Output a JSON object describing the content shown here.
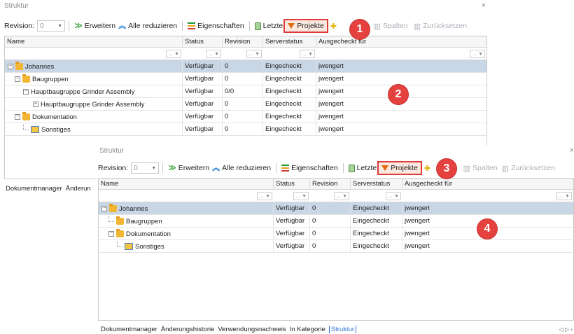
{
  "back": {
    "title": "Struktur",
    "close": "×",
    "toolbar": {
      "revision_label": "Revision:",
      "revision_value": "0",
      "expand": "Erweitern",
      "collapse": "Alle reduzieren",
      "properties": "Eigenschaften",
      "recent": "Letzte",
      "projects": "Projekte",
      "columns_partial": "ten",
      "columns": "Spalten",
      "reset": "Zurücksetzen"
    },
    "columns": [
      "Name",
      "Status",
      "Revision",
      "Serverstatus",
      "Ausgecheckt für"
    ],
    "rows": [
      {
        "name": "Johannes",
        "status": "Verfügbar",
        "revision": "0",
        "server": "Eingecheckt",
        "user": "jwengert"
      },
      {
        "name": "Baugruppen",
        "status": "Verfügbar",
        "revision": "0",
        "server": "Eingecheckt",
        "user": "jwengert"
      },
      {
        "name": "Hauptbaugruppe Grinder Assembly",
        "status": "Verfügbar",
        "revision": "0/0",
        "server": "Eingecheckt",
        "user": "jwengert"
      },
      {
        "name": "Hauptbaugruppe Grinder Assembly",
        "status": "Verfügbar",
        "revision": "0",
        "server": "Eingecheckt",
        "user": "jwengert"
      },
      {
        "name": "Dokumentation",
        "status": "Verfügbar",
        "revision": "0",
        "server": "Eingecheckt",
        "user": "jwengert"
      },
      {
        "name": "Sonstiges",
        "status": "Verfügbar",
        "revision": "0",
        "server": "Eingecheckt",
        "user": "jwengert"
      }
    ],
    "tabs": [
      "Dokumentmanager",
      "Änderun"
    ]
  },
  "front": {
    "title": "Struktur",
    "close": "×",
    "toolbar": {
      "revision_label": "Revision:",
      "revision_value": "0",
      "expand": "Erweitern",
      "collapse": "Alle reduzieren",
      "properties": "Eigenschaften",
      "recent": "Letzte",
      "projects": "Projekte",
      "columns_partial": "ten",
      "columns": "Spalten",
      "reset": "Zurücksetzen"
    },
    "columns": [
      "Name",
      "Status",
      "Revision",
      "Serverstatus",
      "Ausgecheckt für"
    ],
    "rows": [
      {
        "name": "Johannes",
        "status": "Verfügbar",
        "revision": "0",
        "server": "Eingecheckt",
        "user": "jwengert"
      },
      {
        "name": "Baugruppen",
        "status": "Verfügbar",
        "revision": "0",
        "server": "Eingecheckt",
        "user": "jwengert"
      },
      {
        "name": "Dokumentation",
        "status": "Verfügbar",
        "revision": "0",
        "server": "Eingecheckt",
        "user": "jwengert"
      },
      {
        "name": "Sonstiges",
        "status": "Verfügbar",
        "revision": "0",
        "server": "Eingecheckt",
        "user": "jwengert"
      }
    ],
    "tabs": [
      "Dokumentmanager",
      "Änderungshistorie",
      "Verwendungsnachweis",
      "In Kategorie",
      "Struktur"
    ],
    "nav": "◁ ▷ ›"
  },
  "badges": [
    "1",
    "2",
    "3",
    "4"
  ],
  "colors": {
    "highlight": "#e03a3a",
    "badge": "#e5413e",
    "selected_row": "#c9d6e6",
    "active_tab": "#2f6fd1"
  }
}
